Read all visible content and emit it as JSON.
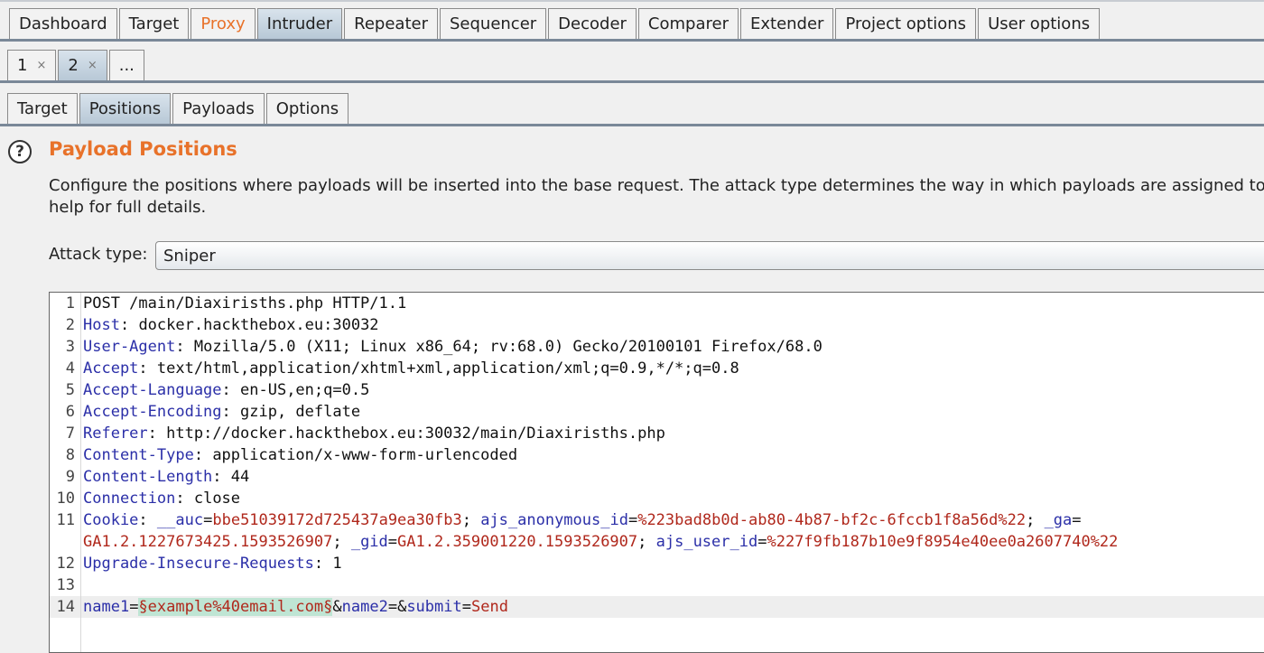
{
  "main_tabs": [
    "Dashboard",
    "Target",
    "Proxy",
    "Intruder",
    "Repeater",
    "Sequencer",
    "Decoder",
    "Comparer",
    "Extender",
    "Project options",
    "User options"
  ],
  "attack_tabs": [
    "1",
    "2",
    "..."
  ],
  "close_glyph": "×",
  "sub_tabs": [
    "Target",
    "Positions",
    "Payloads",
    "Options"
  ],
  "section": {
    "help_glyph": "?",
    "title": "Payload Positions",
    "desc_line1": "Configure the positions where payloads will be inserted into the base request. The attack type determines the way in which payloads are assigned to p",
    "desc_line2": "help for full details."
  },
  "attack_type": {
    "label": "Attack type:",
    "value": "Sniper"
  },
  "request": {
    "line_numbers": [
      "1",
      "2",
      "3",
      "4",
      "5",
      "6",
      "7",
      "8",
      "9",
      "10",
      "11",
      "",
      "12",
      "13",
      "14"
    ],
    "request_line": "POST /main/Diaxirisths.php HTTP/1.1",
    "headers": [
      {
        "name": "Host",
        "value": " docker.hackthebox.eu:30032"
      },
      {
        "name": "User-Agent",
        "value": " Mozilla/5.0 (X11; Linux x86_64; rv:68.0) Gecko/20100101 Firefox/68.0"
      },
      {
        "name": "Accept",
        "value": " text/html,application/xhtml+xml,application/xml;q=0.9,*/*;q=0.8"
      },
      {
        "name": "Accept-Language",
        "value": " en-US,en;q=0.5"
      },
      {
        "name": "Accept-Encoding",
        "value": " gzip, deflate"
      },
      {
        "name": "Referer",
        "value": " http://docker.hackthebox.eu:30032/main/Diaxirisths.php"
      },
      {
        "name": "Content-Type",
        "value": " application/x-www-form-urlencoded"
      },
      {
        "name": "Content-Length",
        "value": " 44"
      },
      {
        "name": "Connection",
        "value": " close"
      }
    ],
    "colon": ":",
    "cookie": {
      "name": "Cookie",
      "auc_name": "__auc",
      "auc_value": "bbe51039172d725437a9ea30fb3",
      "ajs_anon_name": "ajs_anonymous_id",
      "ajs_anon_value": "%223bad8b0d-ab80-4b87-bf2c-6fccb1f8a56d%22",
      "ga_name": "_ga",
      "ga_value": "GA1.2.1227673425.1593526907",
      "gid_name": "_gid",
      "gid_value": "GA1.2.359001220.1593526907",
      "ajs_user_name": "ajs_user_id",
      "ajs_user_value": "%227f9fb187b10e9f8954e40ee0a2607740%22"
    },
    "upgrade": {
      "name": "Upgrade-Insecure-Requests",
      "value": " 1"
    },
    "body": {
      "p1_name": "name1",
      "p1_payload": "§example%40email.com§",
      "p2_name": "name2",
      "p2_value": "",
      "p3_name": "submit",
      "p3_value": "Send"
    }
  }
}
